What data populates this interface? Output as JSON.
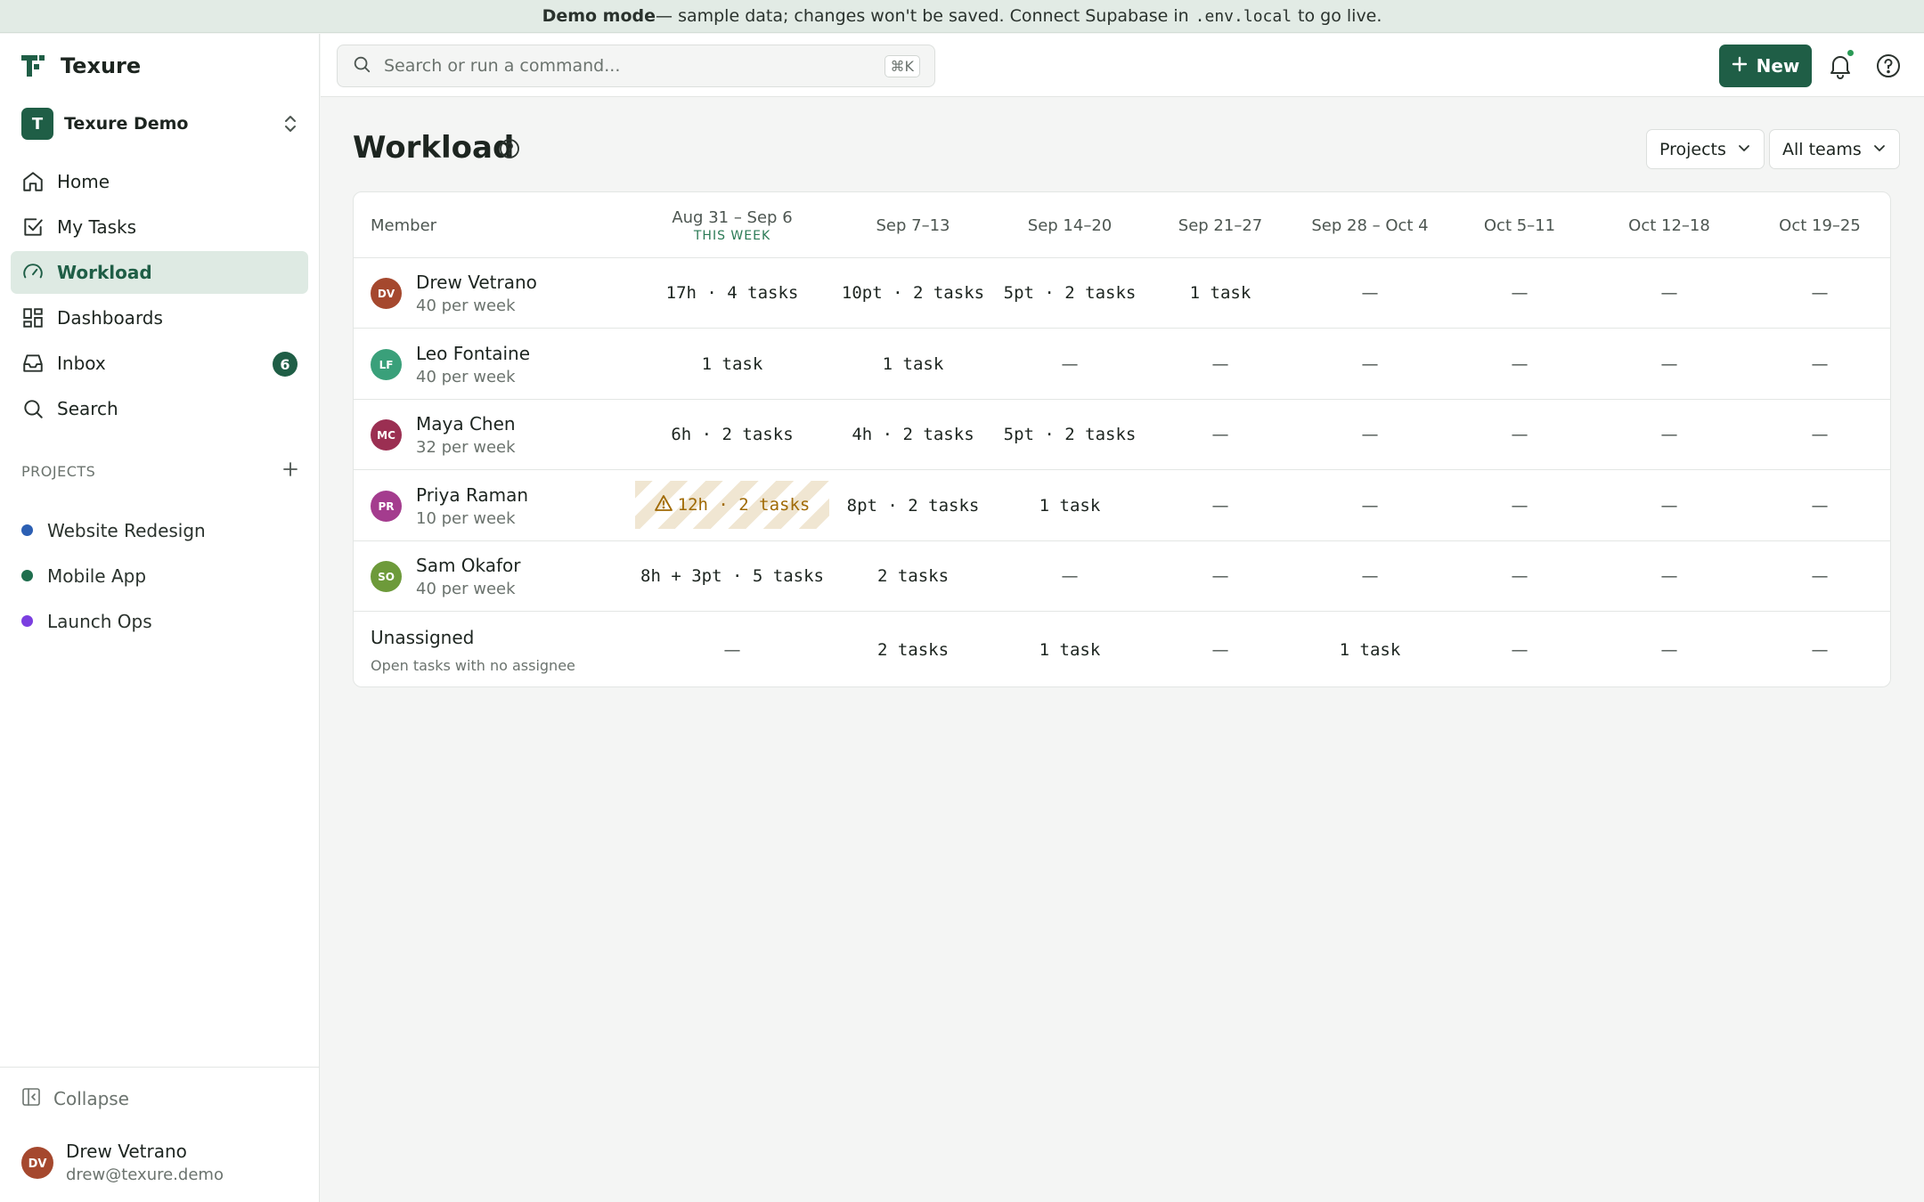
{
  "banner": {
    "bold": "Demo mode",
    "pre": "— sample data; changes won't be saved. Connect Supabase in",
    "code": ".env.local",
    "post": "to go live."
  },
  "app": {
    "name": "Texure"
  },
  "workspace": {
    "initial": "T",
    "name": "Texure Demo"
  },
  "nav": {
    "items": [
      {
        "label": "Home",
        "icon": "home-icon"
      },
      {
        "label": "My Tasks",
        "icon": "check-square-icon"
      },
      {
        "label": "Workload",
        "icon": "gauge-icon",
        "active": true
      },
      {
        "label": "Dashboards",
        "icon": "grid-icon"
      },
      {
        "label": "Inbox",
        "icon": "inbox-icon",
        "count": "6"
      },
      {
        "label": "Search",
        "icon": "search-icon"
      }
    ]
  },
  "projects": {
    "heading": "PROJECTS",
    "items": [
      {
        "name": "Website Redesign",
        "color": "#2c5fb3"
      },
      {
        "name": "Mobile App",
        "color": "#1f6e4e"
      },
      {
        "name": "Launch Ops",
        "color": "#7b3fe0"
      }
    ]
  },
  "sidebar_footer": {
    "collapse": "Collapse",
    "user": {
      "initials": "DV",
      "name": "Drew Vetrano",
      "email": "drew@texure.demo",
      "color": "#a5482e"
    }
  },
  "topbar": {
    "search_placeholder": "Search or run a command...",
    "shortcut": "⌘K",
    "new_label": "New"
  },
  "page": {
    "title": "Workload",
    "group_by": "Projects",
    "team_filter": "All teams"
  },
  "table": {
    "member_header": "Member",
    "weeks": [
      {
        "label": "Aug 31 – Sep 6",
        "sub": "THIS WEEK"
      },
      {
        "label": "Sep 7–13"
      },
      {
        "label": "Sep 14–20"
      },
      {
        "label": "Sep 21–27"
      },
      {
        "label": "Sep 28 – Oct 4"
      },
      {
        "label": "Oct 5–11"
      },
      {
        "label": "Oct 12–18"
      },
      {
        "label": "Oct 19–25"
      }
    ],
    "rows": [
      {
        "initials": "DV",
        "name": "Drew Vetrano",
        "capacity": "40 per week",
        "color": "#a5482e",
        "cells": [
          "17h · 4 tasks",
          "10pt · 2 tasks",
          "5pt · 2 tasks",
          "1 task",
          "—",
          "—",
          "—",
          "—"
        ]
      },
      {
        "initials": "LF",
        "name": "Leo Fontaine",
        "capacity": "40 per week",
        "color": "#3aa07a",
        "cells": [
          "1 task",
          "1 task",
          "—",
          "—",
          "—",
          "—",
          "—",
          "—"
        ]
      },
      {
        "initials": "MC",
        "name": "Maya Chen",
        "capacity": "32 per week",
        "color": "#9b2f52",
        "cells": [
          "6h · 2 tasks",
          "4h · 2 tasks",
          "5pt · 2 tasks",
          "—",
          "—",
          "—",
          "—",
          "—"
        ]
      },
      {
        "initials": "PR",
        "name": "Priya Raman",
        "capacity": "10 per week",
        "color": "#a43c8e",
        "cells": [
          "12h · 2 tasks",
          "8pt · 2 tasks",
          "1 task",
          "—",
          "—",
          "—",
          "—",
          "—"
        ],
        "overloaded_week": 0
      },
      {
        "initials": "SO",
        "name": "Sam Okafor",
        "capacity": "40 per week",
        "color": "#6d9a3a",
        "cells": [
          "8h + 3pt · 5 tasks",
          "2 tasks",
          "—",
          "—",
          "—",
          "—",
          "—",
          "—"
        ]
      }
    ],
    "unassigned": {
      "name": "Unassigned",
      "sub": "Open tasks with no assignee",
      "cells": [
        "—",
        "2 tasks",
        "1 task",
        "—",
        "1 task",
        "—",
        "—",
        "—"
      ]
    }
  }
}
